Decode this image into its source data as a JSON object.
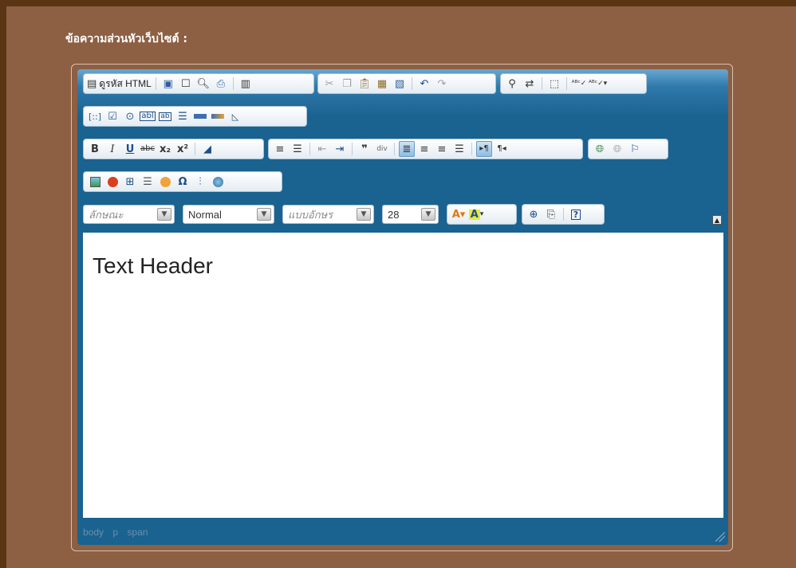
{
  "field_label": "ข้อความส่วนหัวเว็บไซต์ :",
  "toolbar": {
    "source_label": "ดูรหัส HTML",
    "format_placeholder": "ลักษณะ",
    "paragraph_value": "Normal",
    "font_placeholder": "แบบอักษร",
    "size_value": "28"
  },
  "content": {
    "text": "Text Header"
  },
  "status_path": [
    "body",
    "p",
    "span"
  ],
  "colors": {
    "page_border": "#5a3514",
    "panel": "#8d5f43",
    "editor": "#1a6290"
  },
  "icons": {
    "row1": [
      "source-icon",
      "save-icon",
      "new-page-icon",
      "preview-icon",
      "print-icon",
      "templates-icon",
      "cut-icon",
      "copy-icon",
      "paste-icon",
      "paste-text-icon",
      "paste-word-icon",
      "undo-icon",
      "redo-icon",
      "find-icon",
      "replace-icon",
      "select-all-icon",
      "spellcheck-icon",
      "scayt-icon"
    ],
    "row2": [
      "form-icon",
      "checkbox-icon",
      "radio-icon",
      "textfield-icon",
      "textarea-icon",
      "select-icon",
      "button-icon",
      "image-button-icon",
      "hidden-field-icon"
    ],
    "row3": [
      "bold-icon",
      "italic-icon",
      "underline-icon",
      "strike-icon",
      "subscript-icon",
      "superscript-icon",
      "remove-format-icon",
      "numbered-list-icon",
      "bulleted-list-icon",
      "outdent-icon",
      "indent-icon",
      "blockquote-icon",
      "div-icon",
      "align-left-icon",
      "align-center-icon",
      "align-right-icon",
      "justify-icon",
      "ltr-icon",
      "rtl-icon",
      "link-icon",
      "unlink-icon",
      "anchor-icon"
    ],
    "row4": [
      "image-icon",
      "flash-icon",
      "table-icon",
      "horizontal-rule-icon",
      "smiley-icon",
      "special-char-icon",
      "page-break-icon",
      "iframe-icon"
    ],
    "row5": [
      "text-color-icon",
      "bg-color-icon",
      "maximize-icon",
      "show-blocks-icon",
      "about-icon"
    ]
  }
}
